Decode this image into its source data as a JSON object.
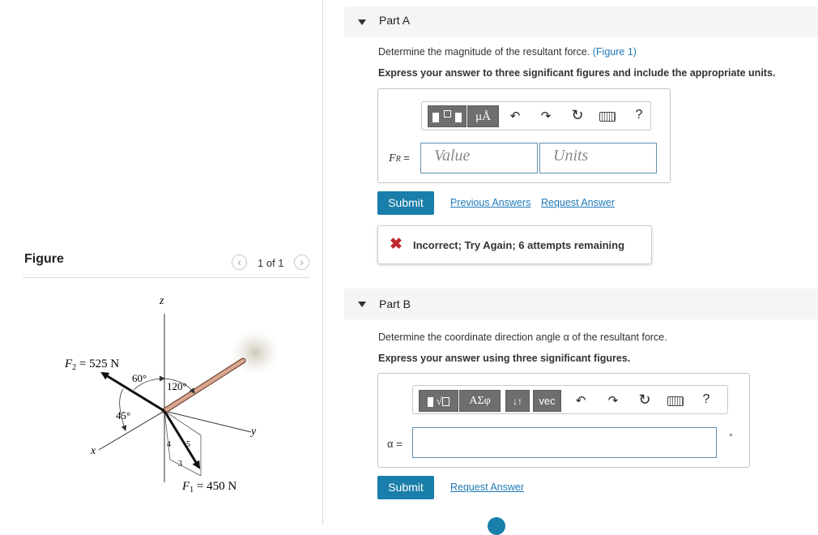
{
  "figure_panel": {
    "title": "Figure",
    "pager": "1 of 1",
    "prev_icon": "chevron-left-icon",
    "next_icon": "chevron-right-icon",
    "diagram": {
      "axis_z": "z",
      "axis_y": "y",
      "axis_x": "x",
      "f2_label": "F",
      "f2_sub": "2",
      "f2_value": " = 525 N",
      "f1_label": "F",
      "f1_sub": "1",
      "f1_value": " = 450 N",
      "angle_60": "60°",
      "angle_120": "120°",
      "angle_45": "45°",
      "tri_4": "4",
      "tri_5": "5",
      "tri_3": "3"
    }
  },
  "part_a": {
    "label": "Part A",
    "prompt": "Determine the magnitude of the resultant force.",
    "figure_link": "(Figure 1)",
    "instruction": "Express your answer to three significant figures and include the appropriate units.",
    "toolbar": {
      "templates_icon": "templates-icon",
      "units_button": "μÅ",
      "undo_icon": "undo-icon",
      "redo_icon": "redo-icon",
      "reset_icon": "reset-icon",
      "keyboard_icon": "keyboard-icon",
      "help": "?"
    },
    "var_label": "F",
    "var_sub": "R",
    "var_eq": " =",
    "value_placeholder": "Value",
    "units_placeholder": "Units",
    "submit": "Submit",
    "previous_answers": "Previous Answers",
    "request_answer": "Request Answer",
    "feedback": "Incorrect; Try Again; 6 attempts remaining",
    "feedback_color": "#c0272d"
  },
  "part_b": {
    "label": "Part B",
    "prompt": "Determine the coordinate direction angle α of the resultant force.",
    "instruction": "Express your answer using three significant figures.",
    "toolbar": {
      "templates_icon": "templates-sqrt-icon",
      "greek_button": "ΑΣφ",
      "sort_button": "↓↑",
      "vec_button": "vec",
      "undo_icon": "undo-icon",
      "redo_icon": "redo-icon",
      "reset_icon": "reset-icon",
      "keyboard_icon": "keyboard-icon",
      "help": "?"
    },
    "var_label": "α =",
    "unit": "°",
    "submit": "Submit",
    "request_answer": "Request Answer"
  },
  "colors": {
    "accent": "#1a7eaa",
    "link": "#1f7ab8",
    "header_bg": "#f5f5f5"
  }
}
